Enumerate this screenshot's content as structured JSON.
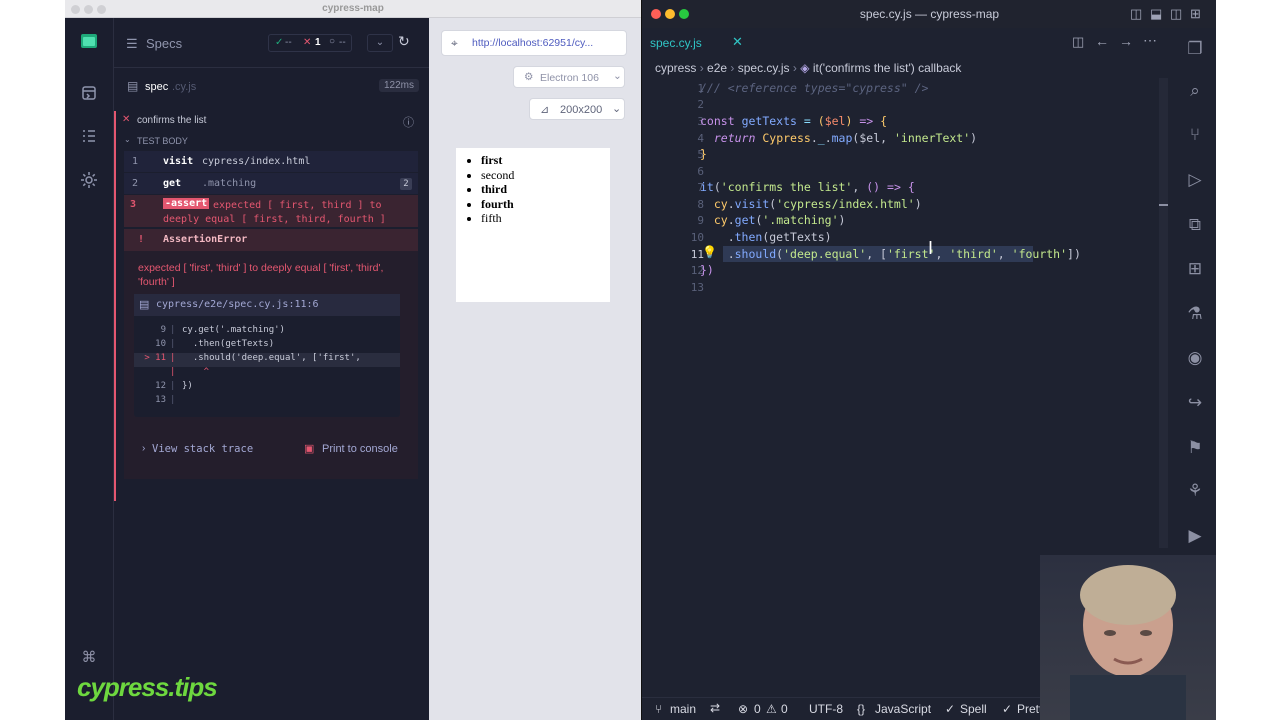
{
  "cypress": {
    "window_title": "cypress-map",
    "header": {
      "title": "Specs",
      "passed_icon": "check-icon",
      "passed_count": "--",
      "failed_count": "1",
      "pending_count": "--"
    },
    "spec": {
      "name": "spec",
      "ext": ".cy.js",
      "duration": "122ms"
    },
    "test": {
      "title": "confirms the list",
      "section": "TEST BODY"
    },
    "commands": [
      {
        "num": "1",
        "name": "visit",
        "msg": "cypress/index.html",
        "badge": ""
      },
      {
        "num": "2",
        "name": "get",
        "msg": ".matching",
        "badge": "2"
      },
      {
        "num": "3",
        "name": "-assert",
        "msg": "expected [ first, third ] to deeply equal [ first, third, fourth ]",
        "badge": ""
      }
    ],
    "error": {
      "bang": "!",
      "type": "AssertionError",
      "message": "expected [ 'first', 'third' ] to deeply equal [ 'first', 'third', 'fourth' ]",
      "file": "cypress/e2e/spec.cy.js:11:6",
      "code_lines": [
        {
          "ln": "9",
          "text": "cy.get('.matching')"
        },
        {
          "ln": "10",
          "text": "  .then(getTexts)"
        },
        {
          "ln": "> 11",
          "text": "  .should('deep.equal', ['first',"
        },
        {
          "ln": "",
          "text": "    ^"
        },
        {
          "ln": "12",
          "text": "})"
        },
        {
          "ln": "13",
          "text": ""
        }
      ],
      "stack_link": "View stack trace",
      "print_button": "Print to console"
    },
    "aut": {
      "url": "http://localhost:62951/cy...",
      "browser": "Electron 106",
      "viewport": "200x200",
      "list": [
        "first",
        "second",
        "third",
        "fourth",
        "fifth"
      ]
    },
    "watermark": "cypress.tips"
  },
  "vscode": {
    "window_title": "spec.cy.js — cypress-map",
    "tab": "spec.cy.js",
    "breadcrumb": [
      "cypress",
      "e2e",
      "spec.cy.js",
      "it('confirms the list') callback"
    ],
    "code": [
      {
        "n": "1",
        "t": "/// <reference types=\"cypress\" />"
      },
      {
        "n": "2",
        "t": ""
      },
      {
        "n": "3",
        "t": "const getTexts = ($el) => {"
      },
      {
        "n": "4",
        "t": "  return Cypress._.map($el, 'innerText')"
      },
      {
        "n": "5",
        "t": "}"
      },
      {
        "n": "6",
        "t": ""
      },
      {
        "n": "7",
        "t": "it('confirms the list', () => {"
      },
      {
        "n": "8",
        "t": "  cy.visit('cypress/index.html')"
      },
      {
        "n": "9",
        "t": "  cy.get('.matching')"
      },
      {
        "n": "10",
        "t": "    .then(getTexts)"
      },
      {
        "n": "11",
        "t": "    .should('deep.equal', ['first', 'third', 'fourth'])"
      },
      {
        "n": "12",
        "t": "})"
      },
      {
        "n": "13",
        "t": ""
      }
    ],
    "status": {
      "branch": "main",
      "errors": "0",
      "warnings": "0",
      "encoding": "UTF-8",
      "language": "JavaScript",
      "spell": "Spell",
      "prettier": "Prettier"
    }
  }
}
